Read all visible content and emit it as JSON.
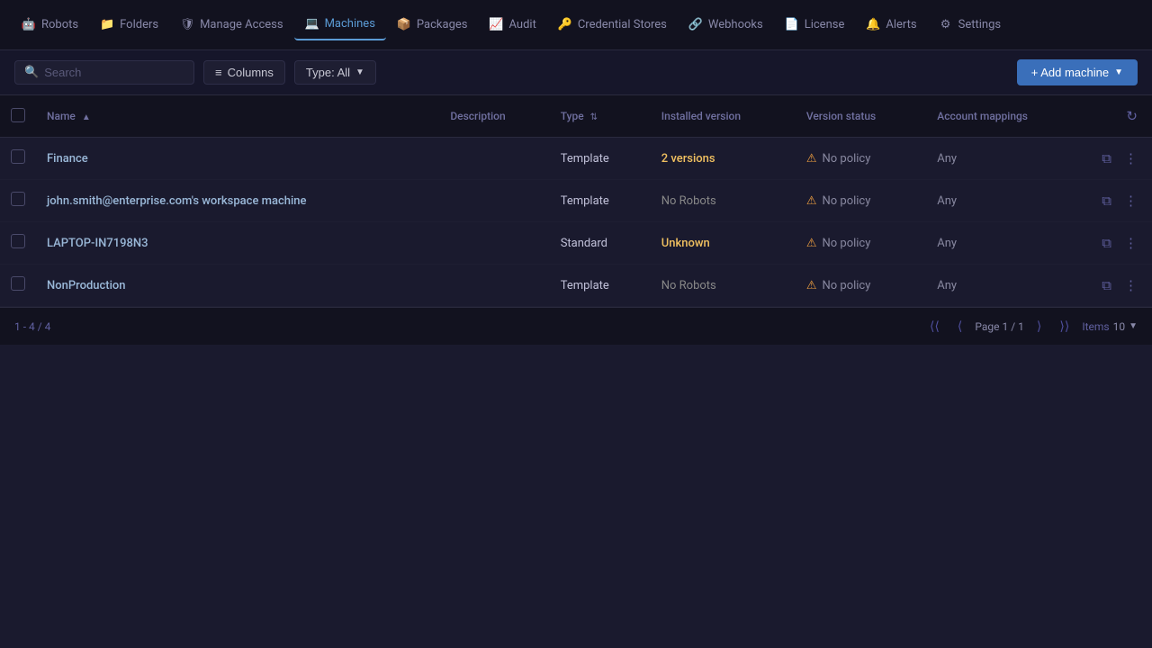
{
  "nav": {
    "items": [
      {
        "label": "Robots",
        "icon": "🤖",
        "active": false,
        "name": "robots"
      },
      {
        "label": "Folders",
        "icon": "📁",
        "active": false,
        "name": "folders"
      },
      {
        "label": "Manage Access",
        "icon": "🛡",
        "active": false,
        "name": "manage-access"
      },
      {
        "label": "Machines",
        "icon": "💻",
        "active": true,
        "name": "machines"
      },
      {
        "label": "Packages",
        "icon": "📦",
        "active": false,
        "name": "packages"
      },
      {
        "label": "Audit",
        "icon": "📈",
        "active": false,
        "name": "audit"
      },
      {
        "label": "Credential Stores",
        "icon": "🔑",
        "active": false,
        "name": "credential-stores"
      },
      {
        "label": "Webhooks",
        "icon": "🔗",
        "active": false,
        "name": "webhooks"
      },
      {
        "label": "License",
        "icon": "📄",
        "active": false,
        "name": "license"
      },
      {
        "label": "Alerts",
        "icon": "🔔",
        "active": false,
        "name": "alerts"
      },
      {
        "label": "Settings",
        "icon": "⚙",
        "active": false,
        "name": "settings"
      }
    ]
  },
  "toolbar": {
    "search_placeholder": "Search",
    "columns_label": "Columns",
    "type_filter_label": "Type: All",
    "add_machine_label": "+ Add machine"
  },
  "table": {
    "columns": [
      {
        "label": "Name",
        "sortable": true,
        "sort_dir": "asc"
      },
      {
        "label": "Description",
        "sortable": false
      },
      {
        "label": "Type",
        "sortable": true
      },
      {
        "label": "Installed version",
        "sortable": false
      },
      {
        "label": "Version status",
        "sortable": false
      },
      {
        "label": "Account mappings",
        "sortable": false
      }
    ],
    "rows": [
      {
        "name": "Finance",
        "description": "",
        "type": "Template",
        "installed_version": "2 versions",
        "installed_version_style": "yellow",
        "version_status": "No policy",
        "account_mappings": "Any"
      },
      {
        "name": "john.smith@enterprise.com's workspace machine",
        "description": "",
        "type": "Template",
        "installed_version": "No Robots",
        "installed_version_style": "grey",
        "version_status": "No policy",
        "account_mappings": "Any"
      },
      {
        "name": "LAPTOP-IN7198N3",
        "description": "",
        "type": "Standard",
        "installed_version": "Unknown",
        "installed_version_style": "yellow",
        "version_status": "No policy",
        "account_mappings": "Any"
      },
      {
        "name": "NonProduction",
        "description": "",
        "type": "Template",
        "installed_version": "No Robots",
        "installed_version_style": "grey",
        "version_status": "No policy",
        "account_mappings": "Any"
      }
    ]
  },
  "pagination": {
    "count_label": "1 - 4 / 4",
    "page_label": "Page 1 / 1",
    "items_label": "Items",
    "items_value": "10"
  }
}
